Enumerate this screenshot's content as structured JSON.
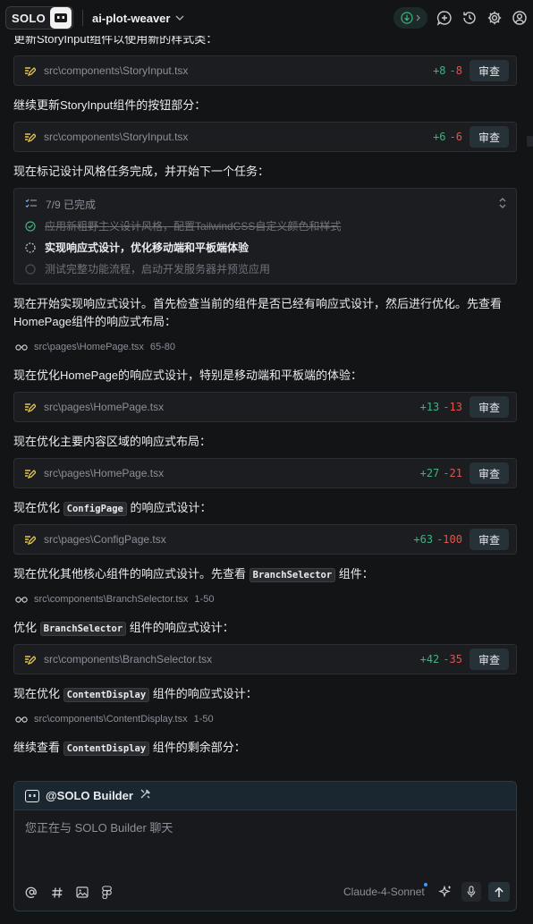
{
  "header": {
    "solo_label": "SOLO",
    "project_name": "ai-plot-weaver"
  },
  "messages": {
    "m1": "更新StoryInput组件以使用新的样式类：",
    "m2": "继续更新StoryInput组件的按钮部分：",
    "m3": "现在标记设计风格任务完成，并开始下一个任务：",
    "m4": "现在开始实现响应式设计。首先检查当前的组件是否已经有响应式设计，然后进行优化。先查看HomePage组件的响应式布局：",
    "m5": "现在优化HomePage的响应式设计，特别是移动端和平板端的体验：",
    "m6": "现在优化主要内容区域的响应式布局：",
    "m7_pre": "现在优化",
    "m7_code": "ConfigPage",
    "m7_post": "的响应式设计：",
    "m8_pre": "现在优化其他核心组件的响应式设计。先查看",
    "m8_code": "BranchSelector",
    "m8_post": "组件：",
    "m9_pre": "优化",
    "m9_code": "BranchSelector",
    "m9_post": "组件的响应式设计：",
    "m10_pre": "现在优化",
    "m10_code": "ContentDisplay",
    "m10_post": "组件的响应式设计：",
    "m11_pre": "继续查看",
    "m11_code": "ContentDisplay",
    "m11_post": "组件的剩余部分："
  },
  "edits": [
    {
      "path": "src\\components\\StoryInput.tsx",
      "added": "+8",
      "removed": "-8",
      "review": "审查"
    },
    {
      "path": "src\\components\\StoryInput.tsx",
      "added": "+6",
      "removed": "-6",
      "review": "审查"
    },
    {
      "path": "src\\pages\\HomePage.tsx",
      "added": "+13",
      "removed": "-13",
      "review": "审查"
    },
    {
      "path": "src\\pages\\HomePage.tsx",
      "added": "+27",
      "removed": "-21",
      "review": "审查"
    },
    {
      "path": "src\\pages\\ConfigPage.tsx",
      "added": "+63",
      "removed": "-100",
      "review": "审查"
    },
    {
      "path": "src\\components\\BranchSelector.tsx",
      "added": "+42",
      "removed": "-35",
      "review": "审查"
    }
  ],
  "reads": [
    {
      "path": "src\\pages\\HomePage.tsx",
      "range": "65-80"
    },
    {
      "path": "src\\components\\BranchSelector.tsx",
      "range": "1-50"
    },
    {
      "path": "src\\components\\ContentDisplay.tsx",
      "range": "1-50"
    }
  ],
  "todo": {
    "progress": "7/9 已完成",
    "items": [
      {
        "label": "应用新粗野主义设计风格，配置TailwindCSS自定义颜色和样式",
        "status": "done"
      },
      {
        "label": "实现响应式设计，优化移动端和平板端体验",
        "status": "in-progress"
      },
      {
        "label": "测试完整功能流程，启动开发服务器并预览应用",
        "status": "pending"
      }
    ]
  },
  "composer": {
    "agent": "@SOLO Builder",
    "placeholder": "您正在与 SOLO Builder 聊天",
    "model": "Claude-4-Sonnet"
  },
  "colors": {
    "background": "#131416",
    "card": "#1b1d20",
    "added": "#3fb37f",
    "removed": "#e5534b",
    "accent": "#3b9cff"
  }
}
